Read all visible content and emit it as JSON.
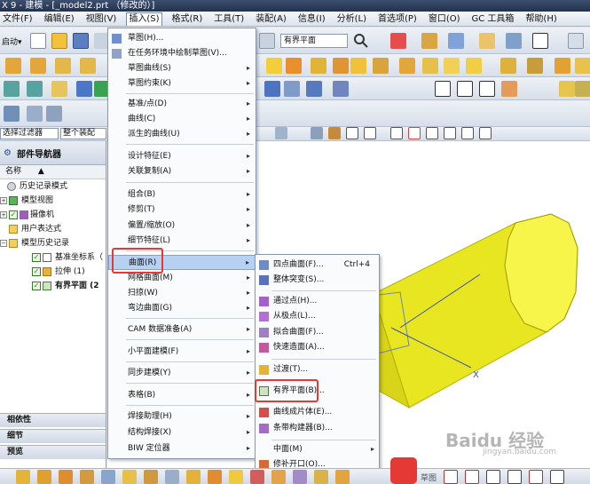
{
  "window": {
    "title": "X 9 - 建模 - [_model2.prt （修改的）]"
  },
  "menubar": {
    "items": [
      "文件(F)",
      "编辑(E)",
      "视图(V)",
      "插入(S)",
      "格式(R)",
      "工具(T)",
      "装配(A)",
      "信息(I)",
      "分析(L)",
      "首选项(P)",
      "窗口(O)",
      "GC 工具箱",
      "帮助(H)"
    ]
  },
  "toolbar": {
    "start_label": "启动▾",
    "search_value": "有界平面",
    "filter_value": "选择过滤器",
    "assembly_value": "整个装配"
  },
  "navigator": {
    "title": "部件导航器",
    "column_header": "名称",
    "items": [
      {
        "label": "历史记录模式"
      },
      {
        "label": "模型视图"
      },
      {
        "label": "摄像机"
      },
      {
        "label": "用户表达式"
      },
      {
        "label": "模型历史记录"
      },
      {
        "label": "基准坐标系（"
      },
      {
        "label": "拉伸 (1)"
      },
      {
        "label": "有界平面 (2"
      }
    ],
    "sections": [
      "相依性",
      "细节",
      "预览"
    ]
  },
  "insert_menu": {
    "items": [
      {
        "label": "草图(H)...",
        "submenu": false
      },
      {
        "label": "在任务环境中绘制草图(V)...",
        "submenu": false
      },
      {
        "label": "草图曲线(S)",
        "submenu": true
      },
      {
        "label": "草图约束(K)",
        "submenu": true
      },
      {
        "label": "基准/点(D)",
        "submenu": true
      },
      {
        "label": "曲线(C)",
        "submenu": true
      },
      {
        "label": "派生的曲线(U)",
        "submenu": true
      },
      {
        "label": "设计特征(E)",
        "submenu": true
      },
      {
        "label": "关联复制(A)",
        "submenu": true
      },
      {
        "label": "组合(B)",
        "submenu": true
      },
      {
        "label": "修剪(T)",
        "submenu": true
      },
      {
        "label": "偏置/缩放(O)",
        "submenu": true
      },
      {
        "label": "细节特征(L)",
        "submenu": true
      },
      {
        "label": "曲面(R)",
        "submenu": true
      },
      {
        "label": "网格曲面(M)",
        "submenu": true
      },
      {
        "label": "扫掠(W)",
        "submenu": true
      },
      {
        "label": "弯边曲面(G)",
        "submenu": true
      },
      {
        "label": "CAM 数据准备(A)",
        "submenu": true
      },
      {
        "label": "小平面建模(F)",
        "submenu": true
      },
      {
        "label": "同步建模(Y)",
        "submenu": true
      },
      {
        "label": "表格(B)",
        "submenu": true
      },
      {
        "label": "焊接助理(H)",
        "submenu": true
      },
      {
        "label": "结构焊接(X)",
        "submenu": true
      },
      {
        "label": "BIW 定位器",
        "submenu": true
      }
    ]
  },
  "surface_menu": {
    "items": [
      {
        "label": "四点曲面(F)...",
        "shortcut": "Ctrl+4"
      },
      {
        "label": "整体突变(S)...",
        "shortcut": ""
      },
      {
        "label": "通过点(H)...",
        "shortcut": ""
      },
      {
        "label": "从极点(L)...",
        "shortcut": ""
      },
      {
        "label": "拟合曲面(F)...",
        "shortcut": ""
      },
      {
        "label": "快速造面(A)...",
        "shortcut": ""
      },
      {
        "label": "过渡(T)...",
        "shortcut": ""
      },
      {
        "label": "有界平面(B)...",
        "shortcut": ""
      },
      {
        "label": "曲线成片体(E)...",
        "shortcut": ""
      },
      {
        "label": "条带构建器(B)...",
        "shortcut": ""
      },
      {
        "label": "中面(M)",
        "shortcut": ""
      },
      {
        "label": "修补开口(O)...",
        "shortcut": ""
      }
    ]
  },
  "viewport": {
    "axis_label": "X"
  },
  "watermark": {
    "text": "Baidu 经验",
    "subtext": "jingyan.baidu.com",
    "bottom_text": "草图"
  },
  "colors": {
    "highlight": "#b7d1f2",
    "callout": "#e53935",
    "model": "#f0ee20"
  }
}
